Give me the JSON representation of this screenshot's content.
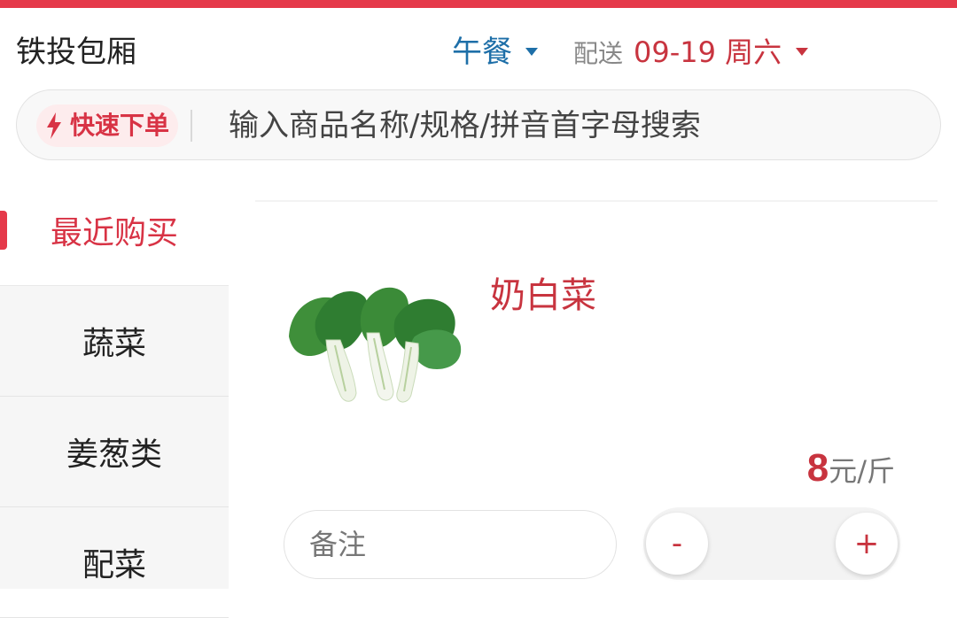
{
  "header": {
    "store_name": "铁投包厢",
    "meal": "午餐",
    "delivery_label": "配送",
    "delivery_date": "09-19 周六"
  },
  "search": {
    "quick_order_label": "快速下单",
    "placeholder": "输入商品名称/规格/拼音首字母搜索"
  },
  "sidebar": {
    "items": [
      {
        "label": "最近购买",
        "active": true
      },
      {
        "label": "蔬菜",
        "active": false
      },
      {
        "label": "姜葱类",
        "active": false
      },
      {
        "label": "配菜",
        "active": false
      }
    ]
  },
  "product": {
    "name": "奶白菜",
    "price_value": "8",
    "price_unit": "元/斤",
    "note_placeholder": "备注",
    "minus_label": "-",
    "plus_label": "+"
  },
  "colors": {
    "accent": "#e5394a",
    "meal": "#1e6fa8"
  },
  "icons": {
    "quick_order": "lightning-icon",
    "meal_dropdown": "caret-down-icon",
    "date_dropdown": "caret-down-icon"
  }
}
